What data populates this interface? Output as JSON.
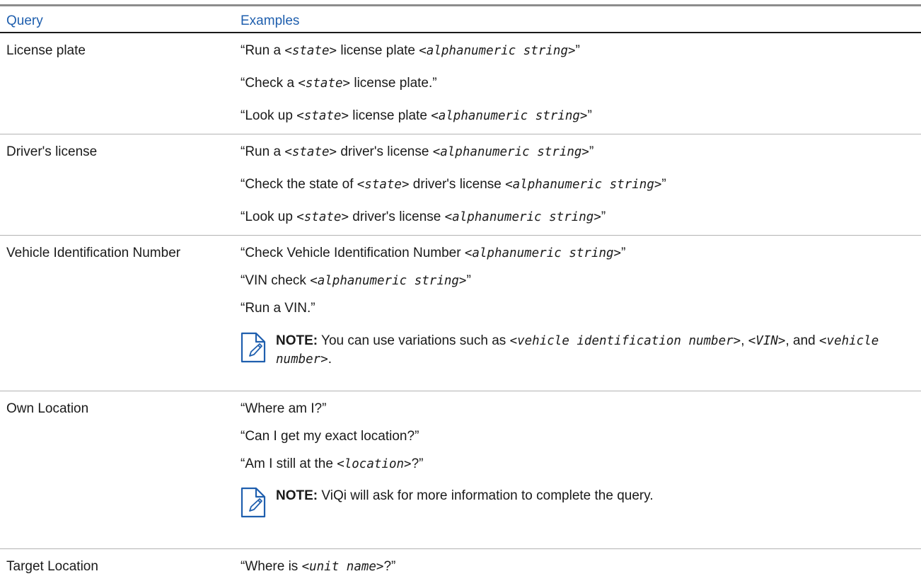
{
  "header": {
    "query": "Query",
    "examples": "Examples"
  },
  "rows": [
    {
      "query": "License plate",
      "examples": [
        {
          "p1": "“Run a ",
          "ph1": "<state>",
          "p2": " license plate ",
          "ph2": "<alphanumeric string>",
          "p3": "”"
        },
        {
          "p1": "“Check a ",
          "ph1": "<state>",
          "p2": " license plate.”",
          "ph2": "",
          "p3": ""
        },
        {
          "p1": "“Look up ",
          "ph1": "<state>",
          "p2": " license plate ",
          "ph2": "<alphanumeric string>",
          "p3": "”"
        }
      ]
    },
    {
      "query": "Driver's license",
      "examples": [
        {
          "p1": "“Run a ",
          "ph1": "<state>",
          "p2": " driver's license ",
          "ph2": "<alphanumeric string>",
          "p3": "”"
        },
        {
          "p1": "“Check the state of ",
          "ph1": "<state>",
          "p2": " driver's license ",
          "ph2": "<alphanumeric string>",
          "p3": "”"
        },
        {
          "p1": "“Look up ",
          "ph1": "<state>",
          "p2": " driver's license ",
          "ph2": "<alphanumeric string>",
          "p3": "”"
        }
      ]
    },
    {
      "query": "Vehicle Identification Number",
      "examples": [
        {
          "p1": "“Check Vehicle Identification Number ",
          "ph1": "<alphanumeric string>",
          "p2": "”"
        },
        {
          "p1": "“VIN check ",
          "ph1": "<alphanumeric string>",
          "p2": "”"
        },
        {
          "p1": "“Run a VIN.”"
        }
      ],
      "note": {
        "label": "NOTE:",
        "t1": " You can use variations such as ",
        "ph1": "<vehicle identification number>",
        "t2": ", ",
        "ph2": "<VIN>",
        "t3": ", and ",
        "ph3": "<vehicle number>",
        "t4": "."
      }
    },
    {
      "query": "Own Location",
      "examples": [
        {
          "p1": "“Where am I?”"
        },
        {
          "p1": "“Can I get my exact location?”"
        },
        {
          "p1": "“Am I still at the ",
          "ph1": "<location>",
          "p2": "?”"
        }
      ],
      "note": {
        "label": "NOTE:",
        "t1": " ViQi will ask for more information to complete the query."
      }
    },
    {
      "query": "Target Location",
      "examples": [
        {
          "p1": "“Where is ",
          "ph1": "<unit name>",
          "p2": "?”"
        }
      ]
    }
  ]
}
